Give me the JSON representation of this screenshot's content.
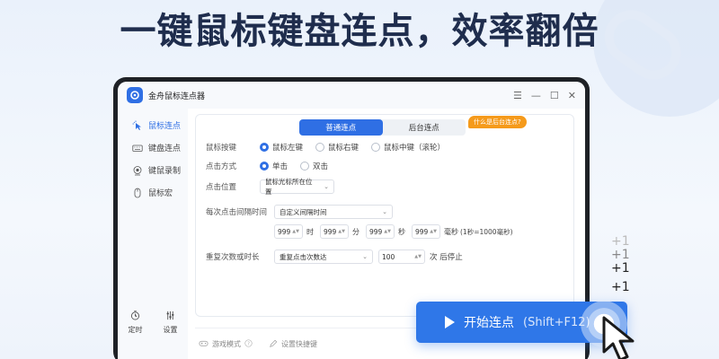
{
  "headline": "一键鼠标键盘连点，效率翻倍",
  "app": {
    "title": "金舟鼠标连点器",
    "window_controls": [
      "☰",
      "—",
      "☐",
      "✕"
    ]
  },
  "sidebar": {
    "items": [
      {
        "label": "鼠标连点",
        "icon": "mouse-click-icon",
        "active": true
      },
      {
        "label": "键盘连点",
        "icon": "keyboard-icon",
        "active": false
      },
      {
        "label": "键鼠录制",
        "icon": "record-icon",
        "active": false
      },
      {
        "label": "鼠标宏",
        "icon": "mouse-icon",
        "active": false
      }
    ],
    "bottom": [
      {
        "label": "定时",
        "icon": "timer-icon"
      },
      {
        "label": "设置",
        "icon": "settings-sliders-icon"
      }
    ]
  },
  "tabs": [
    {
      "label": "普通连点",
      "active": true
    },
    {
      "label": "后台连点",
      "active": false
    }
  ],
  "help_badge": "什么是后台连点?",
  "form": {
    "mouse_button": {
      "label": "鼠标按键",
      "options": [
        {
          "label": "鼠标左键",
          "checked": true
        },
        {
          "label": "鼠标右键",
          "checked": false
        },
        {
          "label": "鼠标中键（滚轮）",
          "checked": false
        }
      ]
    },
    "click_mode": {
      "label": "点击方式",
      "options": [
        {
          "label": "单击",
          "checked": true
        },
        {
          "label": "双击",
          "checked": false
        }
      ]
    },
    "click_position": {
      "label": "点击位置",
      "value": "鼠标光标所在位置"
    },
    "interval": {
      "label": "每次点击间隔时间",
      "mode": "自定义间隔时间",
      "fields": [
        {
          "value": "999",
          "unit": "时"
        },
        {
          "value": "999",
          "unit": "分"
        },
        {
          "value": "999",
          "unit": "秒"
        },
        {
          "value": "999",
          "unit": "毫秒"
        }
      ],
      "hint": "(1秒=1000毫秒)"
    },
    "repeat": {
      "label": "重复次数或时长",
      "mode": "重复点击次数达",
      "count": "100",
      "suffix": "次 后停止"
    }
  },
  "footer": {
    "game_mode": "游戏模式",
    "shortcut": "设置快捷键"
  },
  "start_button": {
    "label": "开始连点",
    "hotkey": "(Shift+F12)"
  },
  "plus_stack": [
    "+1",
    "+1",
    "+1",
    "+1"
  ],
  "colors": {
    "accent": "#2f6fe4",
    "badge": "#f59a1b",
    "headline": "#1f2d4d"
  }
}
